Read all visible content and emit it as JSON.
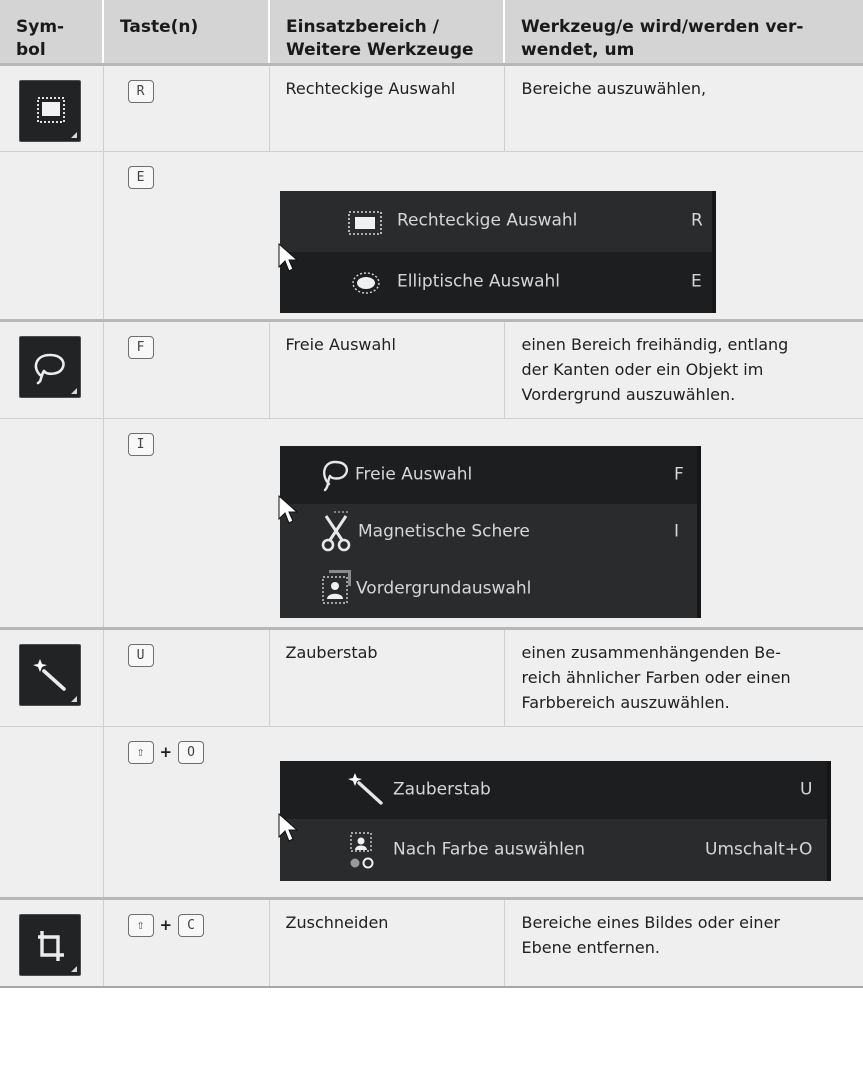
{
  "header": {
    "symbol": "Sym-\nbol",
    "keys": "Taste(n)",
    "area": "Einsatzbereich / Weitere Werkzeuge",
    "purpose": "Werkzeug/e wird/werden ver-wendet, um"
  },
  "header_lines": {
    "symbol": [
      "Sym-",
      "bol"
    ],
    "keys": [
      "Taste(n)"
    ],
    "area": [
      "Einsatzbereich /",
      "Weitere Werkzeuge"
    ],
    "purpose": [
      "Werkzeug/e wird/werden ver-",
      "wendet, um"
    ]
  },
  "rows": [
    {
      "icon": "rect-select-icon",
      "keys": [
        "R"
      ],
      "tool": "Rechteckige Auswahl",
      "purpose": "Bereiche auszuwählen,"
    },
    {
      "keys": [
        "E"
      ],
      "menu": [
        {
          "icon": "rect-select-icon",
          "label": "Rechteckige Auswahl",
          "shortcut": "R"
        },
        {
          "icon": "ellipse-select-icon",
          "label": "Elliptische Auswahl",
          "shortcut": "E"
        }
      ]
    },
    {
      "icon": "lasso-icon",
      "keys": [
        "F"
      ],
      "tool": "Freie Auswahl",
      "purpose_lines": [
        "einen Bereich freihändig, entlang",
        "der Kanten oder ein Objekt im",
        "Vordergrund auszuwählen."
      ]
    },
    {
      "keys": [
        "I"
      ],
      "menu": [
        {
          "icon": "lasso-icon",
          "label": "Freie Auswahl",
          "shortcut": "F"
        },
        {
          "icon": "scissors-icon",
          "label": "Magnetische Schere",
          "shortcut": "I"
        },
        {
          "icon": "foreground-select-icon",
          "label": "Vordergrundauswahl",
          "shortcut": ""
        }
      ]
    },
    {
      "icon": "magic-wand-icon",
      "keys": [
        "U"
      ],
      "tool": "Zauberstab",
      "purpose_lines": [
        "einen zusammenhängenden Be-",
        "reich ähnlicher Farben oder einen",
        "Farbbereich auszuwählen."
      ]
    },
    {
      "keys": [
        "⇧",
        "O"
      ],
      "menu": [
        {
          "icon": "magic-wand-icon",
          "label": "Zauberstab",
          "shortcut": "U"
        },
        {
          "icon": "select-by-color-icon",
          "label": "Nach Farbe auswählen",
          "shortcut": "Umschalt+O"
        }
      ]
    },
    {
      "icon": "crop-icon",
      "keys": [
        "⇧",
        "C"
      ],
      "tool": "Zuschneiden",
      "purpose_lines": [
        "Bereiche eines Bildes oder einer",
        "Ebene entfernen."
      ]
    }
  ],
  "plus_sign": "+",
  "colors": {
    "header_bg": "#d4d4d4",
    "row_bg": "#efefef",
    "menu_bg": "#2a2b2d",
    "menu_highlight": "#1d1e20",
    "menu_text": "#d6d6d6"
  }
}
